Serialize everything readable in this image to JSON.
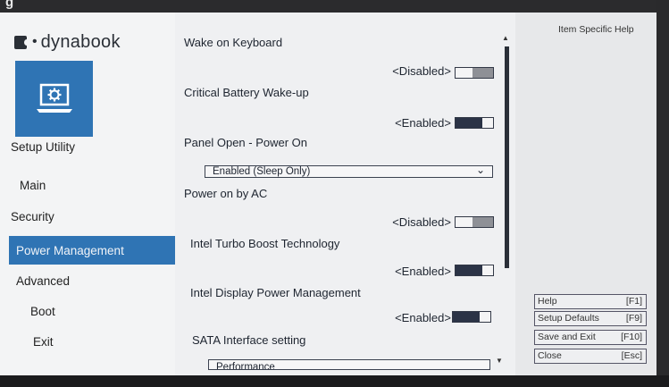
{
  "frame": {
    "partial_top_text": "g"
  },
  "brand": {
    "logo_text": "dynabook",
    "logo_dots": "•"
  },
  "sidebar": {
    "setup_label": "Setup Utility",
    "items": [
      {
        "label": "Main",
        "active": false
      },
      {
        "label": "Security",
        "active": false
      },
      {
        "label": "Power Management",
        "active": true
      },
      {
        "label": "Advanced",
        "active": false
      },
      {
        "label": "Boot",
        "active": false
      },
      {
        "label": "Exit",
        "active": false
      }
    ]
  },
  "settings": [
    {
      "title": "Wake on Keyboard",
      "value": "<Disabled>",
      "control": "toggle",
      "state": "off"
    },
    {
      "title": "Critical Battery Wake-up",
      "value": "<Enabled>",
      "control": "toggle",
      "state": "on"
    },
    {
      "title": "Panel Open - Power On",
      "value": "Enabled (Sleep Only)",
      "control": "dropdown"
    },
    {
      "title": "Power on by AC",
      "value": "<Disabled>",
      "control": "toggle",
      "state": "off"
    },
    {
      "title": "Intel Turbo Boost Technology",
      "value": "<Enabled>",
      "control": "toggle",
      "state": "on"
    },
    {
      "title": "Intel Display Power Management",
      "value": "<Enabled>",
      "control": "toggle",
      "state": "on"
    },
    {
      "title": "SATA Interface setting",
      "value": "Performance",
      "control": "dropdown"
    }
  ],
  "help": {
    "title": "Item Specific Help",
    "keys": [
      {
        "label": "Help",
        "key": "[F1]"
      },
      {
        "label": "Setup Defaults",
        "key": "[F9]"
      },
      {
        "label": "Save and Exit",
        "key": "[F10]"
      },
      {
        "label": "Close",
        "key": "[Esc]"
      }
    ]
  },
  "scroll": {
    "up": "▲",
    "down": "▼"
  },
  "colors": {
    "accent": "#2f74b4",
    "panel": "#eff0f2",
    "sidebar": "#f3f4f5"
  }
}
